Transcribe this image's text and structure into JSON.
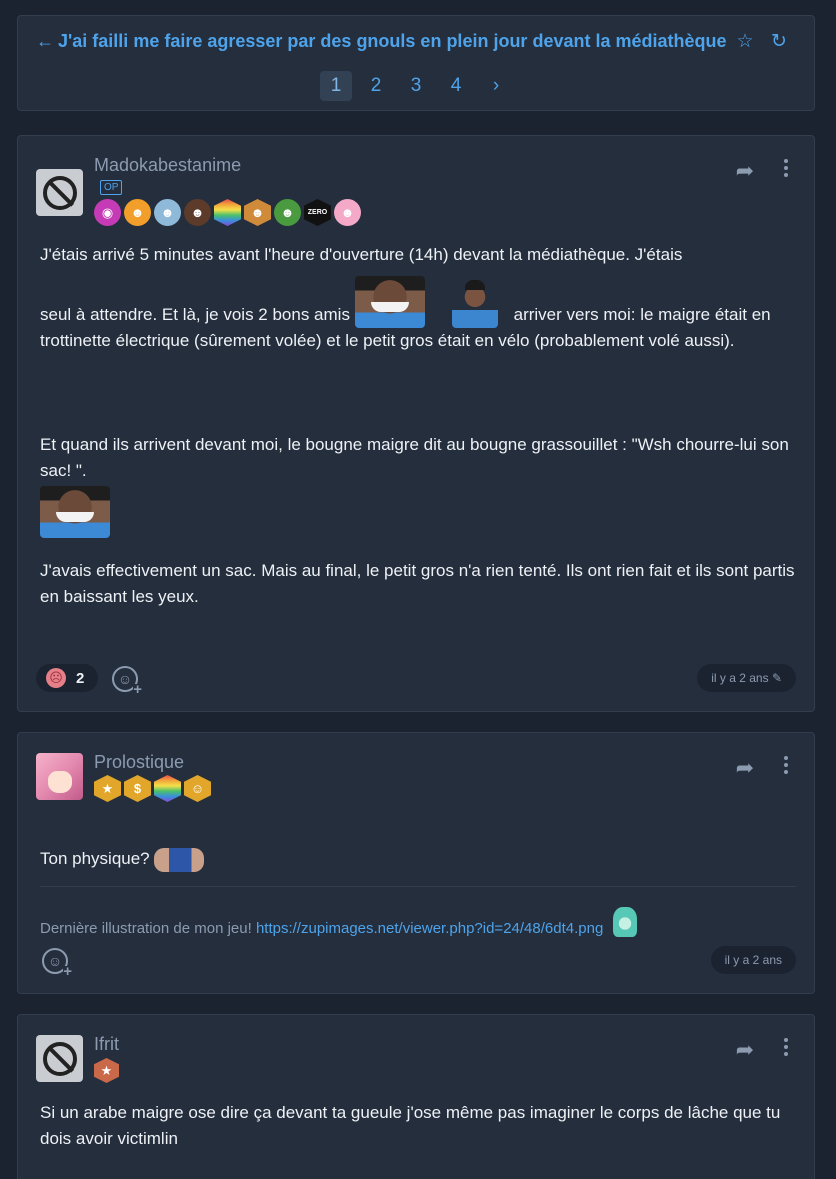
{
  "topic": {
    "title": "J'ai failli me faire agresser par des gnouls en plein jour devant la médiathèque",
    "back_icon": "arrow-left-icon",
    "favorite_icon": "star-icon",
    "refresh_icon": "refresh-icon"
  },
  "pagination": {
    "pages": [
      "1",
      "2",
      "3",
      "4"
    ],
    "active": "1",
    "next": "›"
  },
  "posts": [
    {
      "author": "Madokabestanime",
      "op_label": "OP",
      "avatar": "banned-avatar-icon",
      "badges": 9,
      "paragraphs": [
        "J'étais arrivé 5 minutes avant l'heure d'ouverture (14h) devant la médiathèque. J'étais",
        "seul à attendre. Et là, je vois 2 bons amis",
        "arriver vers moi: le maigre était en trottinette électrique (sûrement volée) et le petit gros était en vélo (probablement volé aussi).",
        "Et quand ils arrivent devant moi, le bougne maigre dit au bougne grassouillet : \"Wsh chourre-lui son sac! \".",
        "J'avais effectivement un sac. Mais au final, le petit gros n'a rien tenté. Ils ont rien fait et ils sont partis en baissant les yeux."
      ],
      "reaction_count": "2",
      "date": "il y a 2 ans",
      "edited_icon": "pencil-icon"
    },
    {
      "author": "Prolostique",
      "avatar": "anime-avatar",
      "text": "Ton physique?",
      "signature_text": "Dernière illustration de mon jeu!",
      "signature_link": "https://zupimages.net/viewer.php?id=24/48/6dt4.png",
      "date": "il y a 2 ans"
    },
    {
      "author": "Ifrit",
      "avatar": "banned-avatar-icon",
      "text": "Si un arabe maigre ose dire ça devant ta gueule j'ose même pas imaginer le corps de lâche que tu dois avoir victimlin"
    }
  ],
  "colors": {
    "background": "#1b2330",
    "card": "#242e3d",
    "accent": "#4ea3ea",
    "muted": "#8c9bb0"
  }
}
